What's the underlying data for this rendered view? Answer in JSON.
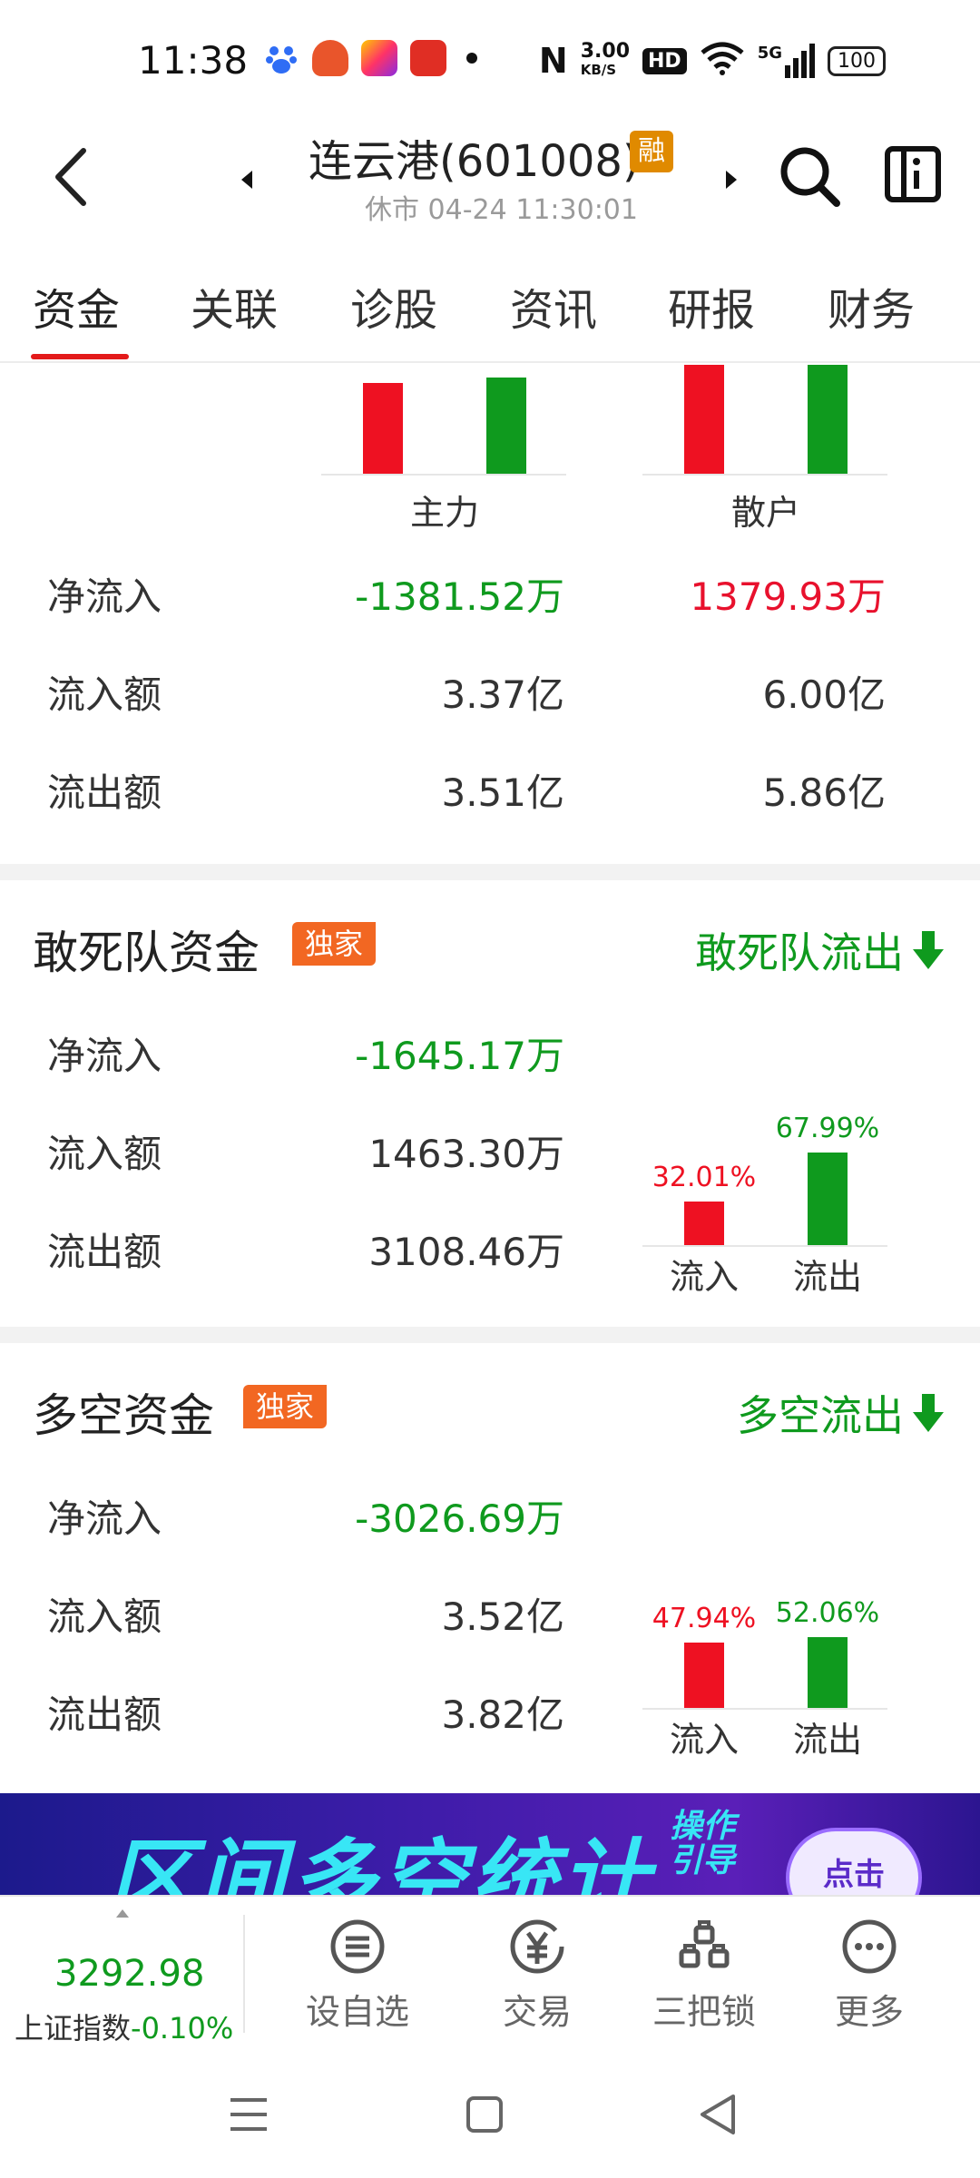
{
  "status_bar": {
    "time": "11:38",
    "speed": "3.00",
    "speed_unit": "KB/S",
    "hd": "HD",
    "net": "5G",
    "battery": "100"
  },
  "header": {
    "title": "连云港(601008)",
    "badge": "融",
    "subtitle": "休市  04-24  11:30:01"
  },
  "tabs": [
    "资金",
    "关联",
    "诊股",
    "资讯",
    "研报",
    "财务"
  ],
  "main_retail": {
    "captions": [
      "主力",
      "散户"
    ],
    "rows": [
      {
        "label": "净流入",
        "main": "-1381.52万",
        "retail": "1379.93万"
      },
      {
        "label": "流入额",
        "main": "3.37亿",
        "retail": "6.00亿"
      },
      {
        "label": "流出额",
        "main": "3.51亿",
        "retail": "5.86亿"
      }
    ]
  },
  "dare": {
    "title": "敢死队资金",
    "badge": "独家",
    "action": "敢死队流出",
    "rows": [
      {
        "label": "净流入",
        "value": "-1645.17万"
      },
      {
        "label": "流入额",
        "value": "1463.30万"
      },
      {
        "label": "流出额",
        "value": "3108.46万"
      }
    ],
    "bars": [
      {
        "caption": "流入",
        "pct_text": "32.01%",
        "pct": 32.01,
        "color": "#ee1122"
      },
      {
        "caption": "流出",
        "pct_text": "67.99%",
        "pct": 67.99,
        "color": "#0f9a1e"
      }
    ]
  },
  "longshort": {
    "title": "多空资金",
    "badge": "独家",
    "action": "多空流出",
    "rows": [
      {
        "label": "净流入",
        "value": "-3026.69万"
      },
      {
        "label": "流入额",
        "value": "3.52亿"
      },
      {
        "label": "流出额",
        "value": "3.82亿"
      }
    ],
    "bars": [
      {
        "caption": "流入",
        "pct_text": "47.94%",
        "pct": 47.94,
        "color": "#ee1122"
      },
      {
        "caption": "流出",
        "pct_text": "52.06%",
        "pct": 52.06,
        "color": "#0f9a1e"
      }
    ]
  },
  "banner": {
    "text": "区间多空统计",
    "sub": "操作\n引导",
    "button": "点击"
  },
  "bottom": {
    "index_value": "3292.98",
    "index_name": "上证指数",
    "index_change": "-0.10%",
    "items": [
      {
        "label": "设自选",
        "icon": "list-icon"
      },
      {
        "label": "交易",
        "icon": "yuan-icon"
      },
      {
        "label": "三把锁",
        "icon": "locks-icon"
      },
      {
        "label": "更多",
        "icon": "more-icon"
      }
    ]
  },
  "colors": {
    "up": "#e8112d",
    "down": "#0f9a1e",
    "accent": "#e31a1a"
  }
}
